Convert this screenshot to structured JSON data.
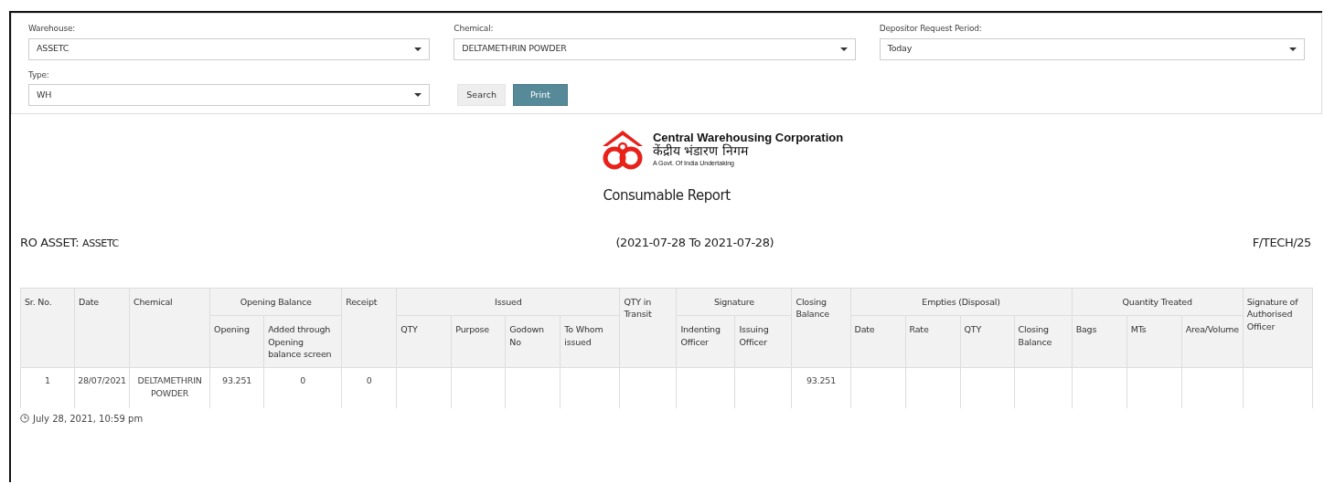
{
  "filters": [
    {
      "label": "Warehouse:",
      "value": "ASSETC"
    },
    {
      "label": "Chemical:",
      "value": "DELTAMETHRIN POWDER"
    },
    {
      "label": "Depositor Request Period:",
      "value": "Today"
    },
    {
      "label": "Type:",
      "value": "WH"
    }
  ],
  "buttons": [
    {
      "label": "Search",
      "kind": "secondary"
    },
    {
      "label": "Print",
      "kind": "primary"
    }
  ],
  "report": {
    "org_name": "Central Warehousing Corporation",
    "org_name_hindi": "केंद्रीय भंडारण निगम",
    "tagline": "A Govt. Of India Undertaking",
    "title": "Consumable Report",
    "ro_label": "RO ASSET:",
    "ro_value": "ASSETC",
    "period": "(2021-07-28 To 2021-07-28)",
    "form_code": "F/TECH/25"
  },
  "table": {
    "header_rows": [
      [
        {
          "label": "Sr. No.",
          "rowspan": 2
        },
        {
          "label": "Date",
          "rowspan": 2
        },
        {
          "label": "Chemical",
          "rowspan": 2
        },
        {
          "label": "Opening Balance",
          "colspan": 2
        },
        {
          "label": "Receipt",
          "rowspan": 2
        },
        {
          "label": "Issued",
          "colspan": 4
        },
        {
          "label": "QTY in Transit",
          "rowspan": 2
        },
        {
          "label": "Signature",
          "colspan": 2
        },
        {
          "label": "Closing Balance",
          "rowspan": 2
        },
        {
          "label": "Empties (Disposal)",
          "colspan": 4
        },
        {
          "label": "Quantity Treated",
          "colspan": 3
        },
        {
          "label": "Signature of Authorised Officer",
          "rowspan": 2
        }
      ],
      [
        {
          "label": "Opening"
        },
        {
          "label": "Added through Opening balance screen"
        },
        {
          "label": "QTY"
        },
        {
          "label": "Purpose"
        },
        {
          "label": "Godown No"
        },
        {
          "label": "To Whom issued"
        },
        {
          "label": "Indenting Officer"
        },
        {
          "label": "Issuing Officer"
        },
        {
          "label": "Date"
        },
        {
          "label": "Rate"
        },
        {
          "label": "QTY"
        },
        {
          "label": "Closing Balance"
        },
        {
          "label": "Bags"
        },
        {
          "label": "MTs"
        },
        {
          "label": "Area/Volume"
        }
      ]
    ],
    "rows": [
      {
        "cells": [
          "1",
          "28/07/2021",
          "DELTAMETHRIN POWDER",
          "93.251",
          "0",
          "0",
          null,
          null,
          null,
          null,
          null,
          null,
          null,
          "93.251",
          null,
          null,
          null,
          null,
          null,
          null,
          null,
          null
        ]
      }
    ]
  },
  "timestamp": "July 28, 2021, 10:59 pm"
}
